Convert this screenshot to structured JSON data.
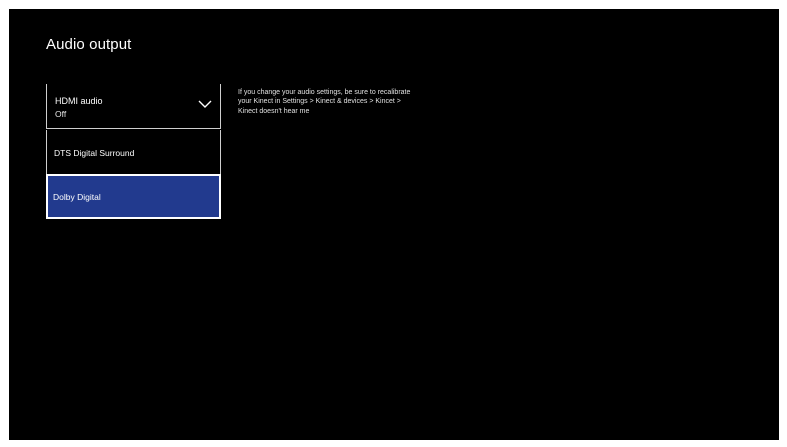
{
  "page": {
    "title": "Audio output"
  },
  "hdmi_audio": {
    "label": "HDMI audio",
    "value": "Off",
    "icon": "chevron-down-icon"
  },
  "options": [
    {
      "label": "DTS Digital Surround",
      "selected": false
    },
    {
      "label": "Dolby Digital",
      "selected": true
    }
  ],
  "help": {
    "text": "If you change your audio settings, be sure to recalibrate your Kinect in Settings > Kinect & devices > Kincet > Kinect doesn't hear me"
  },
  "colors": {
    "background": "#000000",
    "selected": "#223a8e",
    "text": "#ffffff"
  }
}
